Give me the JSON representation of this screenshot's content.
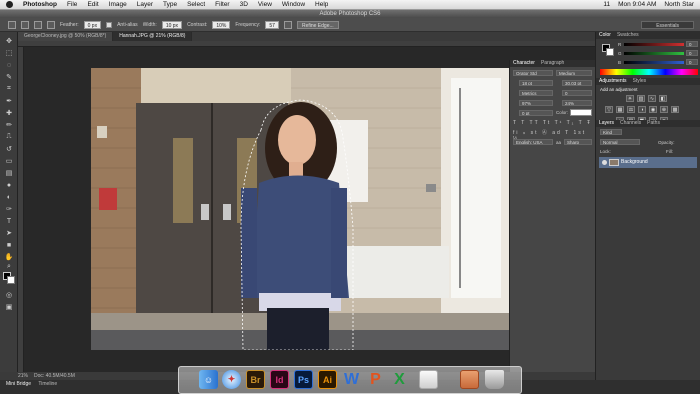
{
  "menubar": {
    "app_name": "Photoshop",
    "items": [
      "File",
      "Edit",
      "Image",
      "Layer",
      "Type",
      "Select",
      "Filter",
      "3D",
      "View",
      "Window",
      "Help"
    ],
    "status_right": [
      "11",
      "Mon 9:04 AM",
      "North Star"
    ]
  },
  "window": {
    "title": "Adobe Photoshop CS6"
  },
  "options": {
    "feather_label": "Feather:",
    "feather_value": "0 px",
    "antialias_label": "Anti-alias",
    "style_label": "Width:",
    "style_value": "10 px",
    "contrast_label": "Contrast:",
    "contrast_value": "10%",
    "frequency_label": "Frequency:",
    "frequency_value": "57",
    "refine_edge": "Refine Edge...",
    "workspace": "Essentials"
  },
  "tabs": [
    {
      "label": "GeorgeClooney.jpg @ 50% (RGB/8*)",
      "active": false
    },
    {
      "label": "Hannah.JPG @ 21% (RGB/8)",
      "active": true
    }
  ],
  "status": {
    "zoom": "21%",
    "doc": "Doc: 40.5M/40.5M"
  },
  "minibridge": {
    "tabs": [
      "Mini Bridge",
      "Timeline"
    ]
  },
  "character_panel": {
    "tabs": [
      "Character",
      "Paragraph"
    ],
    "font_family": "Orator Std",
    "font_style": "Medium",
    "size": "18 pt",
    "leading": "30.03 pt",
    "kerning": "Metrics",
    "tracking": "0",
    "vscale": "97%",
    "hscale": "24%",
    "baseline": "0 pt",
    "color_label": "Color:",
    "language": "English: USA",
    "aa_method": "Sharp",
    "aa_prefix": "aa"
  },
  "color_panel": {
    "tabs": [
      "Color",
      "Swatches"
    ],
    "channels": [
      {
        "name": "R",
        "value": "0",
        "color": "#d03030"
      },
      {
        "name": "G",
        "value": "0",
        "color": "#30c040"
      },
      {
        "name": "B",
        "value": "0",
        "color": "#3060d0"
      }
    ]
  },
  "adjustments_panel": {
    "tabs": [
      "Adjustments",
      "Styles"
    ],
    "heading": "Add an adjustment"
  },
  "layers_panel": {
    "tabs": [
      "Layers",
      "Channels",
      "Paths"
    ],
    "kind": "Kind",
    "blend_mode": "Normal",
    "opacity_label": "Opacity:",
    "lock_label": "Lock:",
    "fill_label": "Fill:",
    "layer_name": "Background"
  },
  "dock": {
    "apps": [
      "Finder",
      "Safari",
      "Br",
      "Id",
      "Ps",
      "Ai",
      "W",
      "P",
      "X",
      "Preview",
      "Photos",
      "Trash"
    ],
    "colors": {
      "br": "#c8902a",
      "id": "#d4307a",
      "ps": "#2e6ed6",
      "ai": "#e8900a",
      "word": "#2f6fd6",
      "ppt": "#e2531d",
      "excel": "#1f9c3c"
    }
  },
  "palette": {
    "accent_selection": "#5a6e8c",
    "panel_bg": "#3a3a3a",
    "app_bg": "#2b2b2b"
  }
}
